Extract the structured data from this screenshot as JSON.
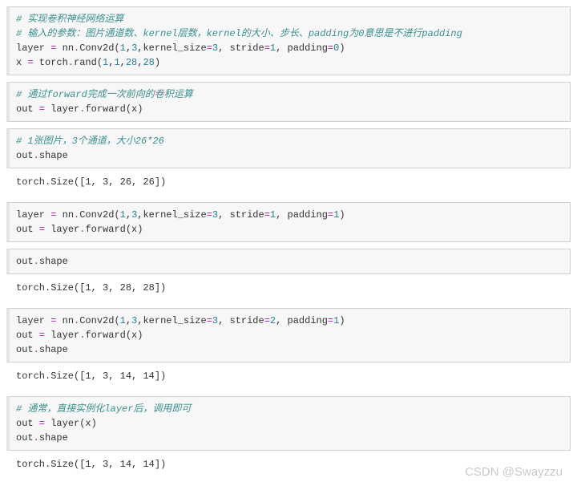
{
  "cells": [
    {
      "type": "code",
      "tokens": [
        {
          "t": "# 实现卷积神经网络运算",
          "c": "cm"
        },
        {
          "t": "\n"
        },
        {
          "t": "# 输入的参数：图片通道数、kernel层数，kernel的大小、步长、padding为0意思是不进行padding",
          "c": "cm"
        },
        {
          "t": "\n"
        },
        {
          "t": "layer ",
          "c": "id"
        },
        {
          "t": "=",
          "c": "op"
        },
        {
          "t": " nn",
          "c": "id"
        },
        {
          "t": ".",
          "c": "op"
        },
        {
          "t": "Conv2d(",
          "c": "id"
        },
        {
          "t": "1",
          "c": "num"
        },
        {
          "t": ",",
          "c": "id"
        },
        {
          "t": "3",
          "c": "num"
        },
        {
          "t": ",kernel_size",
          "c": "id"
        },
        {
          "t": "=",
          "c": "op"
        },
        {
          "t": "3",
          "c": "num"
        },
        {
          "t": ", stride",
          "c": "id"
        },
        {
          "t": "=",
          "c": "op"
        },
        {
          "t": "1",
          "c": "num"
        },
        {
          "t": ", padding",
          "c": "id"
        },
        {
          "t": "=",
          "c": "op"
        },
        {
          "t": "0",
          "c": "num"
        },
        {
          "t": ")",
          "c": "id"
        },
        {
          "t": "\n"
        },
        {
          "t": "x ",
          "c": "id"
        },
        {
          "t": "=",
          "c": "op"
        },
        {
          "t": " torch",
          "c": "id"
        },
        {
          "t": ".",
          "c": "op"
        },
        {
          "t": "rand(",
          "c": "id"
        },
        {
          "t": "1",
          "c": "num"
        },
        {
          "t": ",",
          "c": "id"
        },
        {
          "t": "1",
          "c": "num"
        },
        {
          "t": ",",
          "c": "id"
        },
        {
          "t": "28",
          "c": "num"
        },
        {
          "t": ",",
          "c": "id"
        },
        {
          "t": "28",
          "c": "num"
        },
        {
          "t": ")",
          "c": "id"
        }
      ]
    },
    {
      "type": "gap"
    },
    {
      "type": "code",
      "tokens": [
        {
          "t": "# 通过forward完成一次前向的卷积运算",
          "c": "cm"
        },
        {
          "t": "\n"
        },
        {
          "t": "out ",
          "c": "id"
        },
        {
          "t": "=",
          "c": "op"
        },
        {
          "t": " layer",
          "c": "id"
        },
        {
          "t": ".",
          "c": "op"
        },
        {
          "t": "forward(x)",
          "c": "id"
        }
      ]
    },
    {
      "type": "gap"
    },
    {
      "type": "code",
      "tokens": [
        {
          "t": "# 1张图片，3个通道，大小26*26",
          "c": "cm"
        },
        {
          "t": "\n"
        },
        {
          "t": "out",
          "c": "id"
        },
        {
          "t": ".",
          "c": "op"
        },
        {
          "t": "shape",
          "c": "id"
        }
      ]
    },
    {
      "type": "output",
      "text": "torch.Size([1, 3, 26, 26])"
    },
    {
      "type": "gap"
    },
    {
      "type": "code",
      "tokens": [
        {
          "t": "layer ",
          "c": "id"
        },
        {
          "t": "=",
          "c": "op"
        },
        {
          "t": " nn",
          "c": "id"
        },
        {
          "t": ".",
          "c": "op"
        },
        {
          "t": "Conv2d(",
          "c": "id"
        },
        {
          "t": "1",
          "c": "num"
        },
        {
          "t": ",",
          "c": "id"
        },
        {
          "t": "3",
          "c": "num"
        },
        {
          "t": ",kernel_size",
          "c": "id"
        },
        {
          "t": "=",
          "c": "op"
        },
        {
          "t": "3",
          "c": "num"
        },
        {
          "t": ", stride",
          "c": "id"
        },
        {
          "t": "=",
          "c": "op"
        },
        {
          "t": "1",
          "c": "num"
        },
        {
          "t": ", padding",
          "c": "id"
        },
        {
          "t": "=",
          "c": "op"
        },
        {
          "t": "1",
          "c": "num"
        },
        {
          "t": ")",
          "c": "id"
        },
        {
          "t": "\n"
        },
        {
          "t": "out ",
          "c": "id"
        },
        {
          "t": "=",
          "c": "op"
        },
        {
          "t": " layer",
          "c": "id"
        },
        {
          "t": ".",
          "c": "op"
        },
        {
          "t": "forward(x)",
          "c": "id"
        }
      ]
    },
    {
      "type": "gap"
    },
    {
      "type": "code",
      "tokens": [
        {
          "t": "out",
          "c": "id"
        },
        {
          "t": ".",
          "c": "op"
        },
        {
          "t": "shape",
          "c": "id"
        }
      ]
    },
    {
      "type": "output",
      "text": "torch.Size([1, 3, 28, 28])"
    },
    {
      "type": "gap"
    },
    {
      "type": "code",
      "tokens": [
        {
          "t": "layer ",
          "c": "id"
        },
        {
          "t": "=",
          "c": "op"
        },
        {
          "t": " nn",
          "c": "id"
        },
        {
          "t": ".",
          "c": "op"
        },
        {
          "t": "Conv2d(",
          "c": "id"
        },
        {
          "t": "1",
          "c": "num"
        },
        {
          "t": ",",
          "c": "id"
        },
        {
          "t": "3",
          "c": "num"
        },
        {
          "t": ",kernel_size",
          "c": "id"
        },
        {
          "t": "=",
          "c": "op"
        },
        {
          "t": "3",
          "c": "num"
        },
        {
          "t": ", stride",
          "c": "id"
        },
        {
          "t": "=",
          "c": "op"
        },
        {
          "t": "2",
          "c": "num"
        },
        {
          "t": ", padding",
          "c": "id"
        },
        {
          "t": "=",
          "c": "op"
        },
        {
          "t": "1",
          "c": "num"
        },
        {
          "t": ")",
          "c": "id"
        },
        {
          "t": "\n"
        },
        {
          "t": "out ",
          "c": "id"
        },
        {
          "t": "=",
          "c": "op"
        },
        {
          "t": " layer",
          "c": "id"
        },
        {
          "t": ".",
          "c": "op"
        },
        {
          "t": "forward(x)",
          "c": "id"
        },
        {
          "t": "\n"
        },
        {
          "t": "out",
          "c": "id"
        },
        {
          "t": ".",
          "c": "op"
        },
        {
          "t": "shape",
          "c": "id"
        }
      ]
    },
    {
      "type": "output",
      "text": "torch.Size([1, 3, 14, 14])"
    },
    {
      "type": "gap"
    },
    {
      "type": "code",
      "tokens": [
        {
          "t": "# 通常，直接实例化layer后，调用即可",
          "c": "cm"
        },
        {
          "t": "\n"
        },
        {
          "t": "out ",
          "c": "id"
        },
        {
          "t": "=",
          "c": "op"
        },
        {
          "t": " layer(x)",
          "c": "id"
        },
        {
          "t": "\n"
        },
        {
          "t": "out",
          "c": "id"
        },
        {
          "t": ".",
          "c": "op"
        },
        {
          "t": "shape",
          "c": "id"
        }
      ]
    },
    {
      "type": "output",
      "text": "torch.Size([1, 3, 14, 14])"
    }
  ],
  "watermark": "CSDN @Swayzzu"
}
